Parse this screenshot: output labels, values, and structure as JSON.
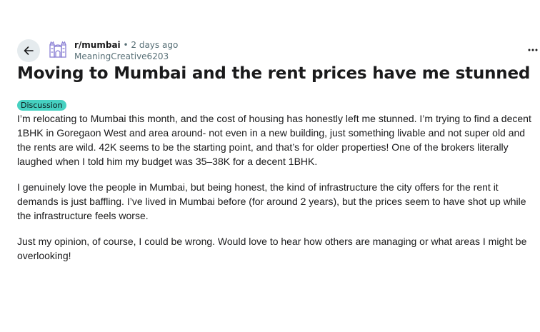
{
  "post": {
    "subreddit": "r/mumbai",
    "separator": "•",
    "timestamp": "2 days ago",
    "author": "MeaningCreative6203",
    "title": "Moving to Mumbai and the rent prices have me stunned",
    "flair": "Discussion",
    "flair_color": "#46d1c1",
    "paragraphs": [
      "I’m relocating to Mumbai this month, and the cost of housing has honestly left me stunned. I’m trying to find a decent 1BHK in Goregaon West and area around- not even in a new building, just something livable and not super old and the rents are wild. 42K seems to be the starting point, and that’s for older properties! One of the brokers literally laughed when I told him my budget was 35–38K for a decent 1BHK.",
      "I genuinely love the people in Mumbai, but being honest, the kind of infrastructure the city offers for the rent it demands is just baffling. I’ve lived in Mumbai before (for around 2 years), but the prices seem to have shot up while the infrastructure feels worse.",
      "Just my opinion, of course, I could be wrong. Would love to hear how others are managing or what areas I might be overlooking!"
    ]
  },
  "icons": {
    "back": "arrow-left-icon",
    "subreddit": "gateway-of-india-icon",
    "more": "ellipsis-icon"
  },
  "colors": {
    "back_button_bg": "#e5ebee",
    "subreddit_icon": "#8a7fd4",
    "meta_text": "#576f76"
  }
}
